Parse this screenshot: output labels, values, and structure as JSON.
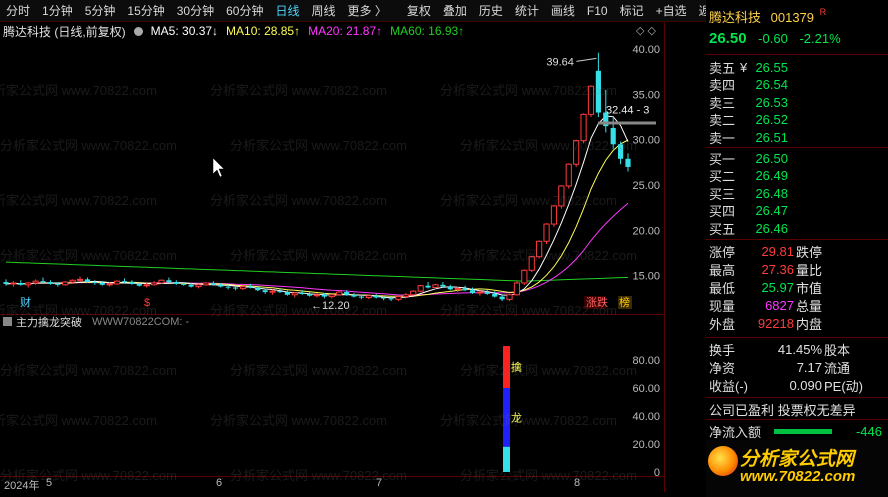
{
  "toolbar": {
    "periods": [
      "分时",
      "1分钟",
      "5分钟",
      "15分钟",
      "30分钟",
      "60分钟",
      "日线",
      "周线",
      "更多 〉"
    ],
    "active_period": "日线",
    "tools": [
      "复权",
      "叠加",
      "历史",
      "统计",
      "画线",
      "F10",
      "标记",
      "+自选",
      "返回"
    ]
  },
  "info": {
    "title": "腾达科技 (日线,前复权)",
    "ma5": "MA5: 30.37↓",
    "ma10": "MA10: 28.85↑",
    "ma20": "MA20: 21.87↑",
    "ma60": "MA60: 16.93↑",
    "corner": "◇ ◇"
  },
  "colors": {
    "up": "#ff3b3b",
    "down": "#35e0e8",
    "ma5": "#ffffff",
    "ma10": "#ffff55",
    "ma20": "#ff38ff",
    "ma60": "#20d020",
    "green": "#00e64c"
  },
  "chart_data": {
    "type": "candlestick",
    "y_axis": [
      "40.00",
      "35.00",
      "30.00",
      "25.00",
      "20.00",
      "15.00"
    ],
    "ylim": [
      11.0,
      41.0
    ],
    "annotations": {
      "high": "39.64",
      "price_line": "32.44 - 3",
      "low": "←12.20",
      "markers": [
        "财",
        "$",
        "涨跌",
        "榜"
      ]
    },
    "ohlc": [
      [
        14.3,
        14.6,
        13.9,
        14.1
      ],
      [
        14.1,
        14.4,
        13.8,
        14.2
      ],
      [
        14.2,
        14.5,
        13.9,
        14.0
      ],
      [
        14.0,
        14.3,
        13.7,
        14.2
      ],
      [
        14.2,
        14.6,
        14.0,
        14.4
      ],
      [
        14.4,
        14.8,
        14.2,
        14.3
      ],
      [
        14.3,
        14.5,
        14.0,
        14.1
      ],
      [
        14.1,
        14.3,
        13.8,
        14.0
      ],
      [
        14.0,
        14.4,
        13.9,
        14.3
      ],
      [
        14.3,
        14.6,
        14.1,
        14.5
      ],
      [
        14.5,
        14.9,
        14.3,
        14.6
      ],
      [
        14.6,
        14.8,
        14.2,
        14.3
      ],
      [
        14.3,
        14.5,
        14.0,
        14.2
      ],
      [
        14.2,
        14.4,
        13.9,
        14.0
      ],
      [
        14.0,
        14.3,
        13.8,
        14.1
      ],
      [
        14.1,
        14.5,
        14.0,
        14.4
      ],
      [
        14.4,
        14.7,
        14.2,
        14.3
      ],
      [
        14.3,
        14.5,
        14.0,
        14.1
      ],
      [
        14.1,
        14.3,
        13.8,
        13.9
      ],
      [
        13.9,
        14.2,
        13.7,
        14.0
      ],
      [
        14.0,
        14.4,
        13.9,
        14.2
      ],
      [
        14.2,
        14.6,
        14.1,
        14.5
      ],
      [
        14.5,
        14.8,
        14.2,
        14.3
      ],
      [
        14.3,
        14.5,
        14.0,
        14.1
      ],
      [
        14.1,
        14.3,
        13.9,
        14.0
      ],
      [
        14.0,
        14.2,
        13.7,
        13.8
      ],
      [
        13.8,
        14.1,
        13.6,
        14.0
      ],
      [
        14.0,
        14.3,
        13.9,
        14.2
      ],
      [
        14.2,
        14.4,
        13.9,
        14.0
      ],
      [
        14.0,
        14.2,
        13.7,
        13.8
      ],
      [
        13.8,
        14.0,
        13.5,
        13.7
      ],
      [
        13.7,
        13.9,
        13.4,
        13.6
      ],
      [
        13.6,
        13.9,
        13.4,
        13.8
      ],
      [
        13.8,
        14.1,
        13.6,
        13.7
      ],
      [
        13.7,
        13.9,
        13.3,
        13.4
      ],
      [
        13.4,
        13.6,
        13.0,
        13.2
      ],
      [
        13.2,
        13.5,
        12.9,
        13.3
      ],
      [
        13.3,
        13.6,
        13.1,
        13.2
      ],
      [
        13.2,
        13.4,
        12.8,
        12.9
      ],
      [
        12.9,
        13.2,
        12.6,
        13.1
      ],
      [
        13.1,
        13.4,
        12.9,
        13.0
      ],
      [
        13.0,
        13.2,
        12.7,
        12.8
      ],
      [
        12.8,
        13.1,
        12.6,
        12.9
      ],
      [
        12.9,
        13.1,
        12.5,
        12.7
      ],
      [
        12.7,
        13.0,
        12.5,
        12.9
      ],
      [
        12.9,
        13.3,
        12.8,
        13.2
      ],
      [
        13.2,
        13.4,
        12.8,
        12.9
      ],
      [
        12.9,
        13.1,
        12.6,
        12.7
      ],
      [
        12.7,
        12.9,
        12.4,
        12.6
      ],
      [
        12.6,
        12.9,
        12.4,
        12.8
      ],
      [
        12.8,
        13.0,
        12.5,
        12.6
      ],
      [
        12.6,
        12.8,
        12.3,
        12.5
      ],
      [
        12.5,
        12.7,
        12.2,
        12.4
      ],
      [
        12.4,
        12.8,
        12.2,
        12.7
      ],
      [
        12.7,
        13.1,
        12.5,
        12.9
      ],
      [
        12.9,
        13.4,
        12.8,
        13.3
      ],
      [
        13.3,
        14.0,
        13.2,
        13.9
      ],
      [
        13.9,
        14.3,
        13.6,
        13.7
      ],
      [
        13.7,
        14.1,
        13.5,
        14.0
      ],
      [
        14.0,
        14.3,
        13.7,
        13.8
      ],
      [
        13.8,
        14.0,
        13.4,
        13.5
      ],
      [
        13.5,
        13.8,
        13.2,
        13.6
      ],
      [
        13.6,
        13.9,
        13.3,
        13.4
      ],
      [
        13.4,
        13.7,
        13.0,
        13.1
      ],
      [
        13.1,
        13.4,
        12.8,
        13.2
      ],
      [
        13.2,
        13.5,
        12.9,
        13.0
      ],
      [
        13.0,
        13.3,
        12.6,
        12.7
      ],
      [
        12.7,
        12.9,
        12.2,
        12.4
      ],
      [
        12.4,
        13.0,
        12.2,
        12.9
      ],
      [
        12.9,
        14.4,
        12.8,
        14.2
      ],
      [
        14.2,
        15.7,
        14.0,
        15.6
      ],
      [
        15.6,
        17.2,
        15.4,
        17.1
      ],
      [
        17.1,
        18.9,
        16.9,
        18.8
      ],
      [
        18.8,
        20.8,
        18.5,
        20.7
      ],
      [
        20.7,
        22.8,
        20.4,
        22.7
      ],
      [
        22.7,
        25.0,
        22.4,
        24.9
      ],
      [
        24.9,
        27.4,
        24.6,
        27.3
      ],
      [
        27.3,
        30.0,
        27.0,
        29.9
      ],
      [
        29.9,
        32.9,
        29.6,
        32.8
      ],
      [
        32.8,
        36.0,
        32.5,
        35.9
      ],
      [
        37.6,
        39.6,
        32.5,
        33.0
      ],
      [
        33.0,
        35.5,
        30.8,
        31.5
      ],
      [
        31.3,
        32.4,
        29.0,
        29.5
      ],
      [
        29.5,
        29.8,
        27.3,
        27.9
      ],
      [
        27.9,
        28.5,
        26.5,
        27.0
      ]
    ],
    "dates": [
      "2024年",
      "5",
      "6",
      "7",
      "8"
    ],
    "sub_indicator": {
      "name": "主力擒龙突破",
      "source": "WWW70822COM: -",
      "y_axis": [
        "80.00",
        "60.00",
        "40.00",
        "20.00",
        "0"
      ],
      "ylim": [
        0,
        100
      ],
      "bar_segments": [
        {
          "from": 60,
          "to": 90,
          "color": "#ff2020",
          "label": "擒"
        },
        {
          "from": 18,
          "to": 60,
          "color": "#2020ff",
          "label": "龙"
        },
        {
          "from": 0,
          "to": 18,
          "color": "#35e0e8",
          "label": ""
        }
      ]
    }
  },
  "quote": {
    "name": "腾达科技",
    "code": "001379",
    "r_badge": "R",
    "price": "26.50",
    "change": "-0.60",
    "change_pct": "-2.21%"
  },
  "asks": [
    {
      "label": "卖五",
      "mark": "¥",
      "price": "26.55"
    },
    {
      "label": "卖四",
      "mark": "",
      "price": "26.54"
    },
    {
      "label": "卖三",
      "mark": "",
      "price": "26.53"
    },
    {
      "label": "卖二",
      "mark": "",
      "price": "26.52"
    },
    {
      "label": "卖一",
      "mark": "",
      "price": "26.51"
    }
  ],
  "bids": [
    {
      "label": "买一",
      "price": "26.50"
    },
    {
      "label": "买二",
      "price": "26.49"
    },
    {
      "label": "买三",
      "price": "26.48"
    },
    {
      "label": "买四",
      "price": "26.47"
    },
    {
      "label": "买五",
      "price": "26.46"
    }
  ],
  "stats": [
    {
      "k": "涨停",
      "v": "29.81",
      "vc": "rd",
      "r": "跌停"
    },
    {
      "k": "最高",
      "v": "27.36",
      "vc": "rd",
      "r": "量比"
    },
    {
      "k": "最低",
      "v": "25.97",
      "vc": "g",
      "r": "市值"
    },
    {
      "k": "现量",
      "v": "6827",
      "vc": "mg",
      "r": "总量"
    },
    {
      "k": "外盘",
      "v": "92218",
      "vc": "rd",
      "r": "内盘"
    }
  ],
  "fundamentals": [
    {
      "k": "换手",
      "v": "41.45%",
      "r": "股本"
    },
    {
      "k": "净资",
      "v": "7.17",
      "r": "流通"
    },
    {
      "k": "收益(-)",
      "v": "0.090",
      "r": "PE(动)"
    }
  ],
  "company_note": "公司已盈利 投票权无差异",
  "net_inflow": {
    "label": "净流入额",
    "value": "-446",
    "bar_fraction": 0.72
  },
  "logo": {
    "main": "分析家公式网",
    "url": "www.70822.com"
  },
  "watermark": "分析家公式网 www.70822.com"
}
